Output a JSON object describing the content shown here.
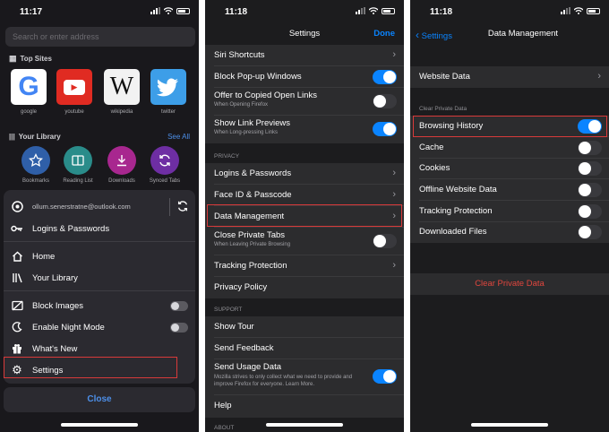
{
  "phone1": {
    "time": "11:17",
    "search_placeholder": "Search or enter address",
    "top_sites_title": "Top Sites",
    "sites": [
      {
        "label": "google",
        "icon": "google-icon"
      },
      {
        "label": "youtube",
        "icon": "youtube-icon"
      },
      {
        "label": "wikipedia",
        "icon": "wikipedia-icon"
      },
      {
        "label": "twitter",
        "icon": "twitter-icon"
      }
    ],
    "library_title": "Your Library",
    "see_all": "See All",
    "library": [
      {
        "label": "Bookmarks",
        "icon": "star-icon",
        "color": "#2f5fa8"
      },
      {
        "label": "Reading List",
        "icon": "book-icon",
        "color": "#2a8c8a"
      },
      {
        "label": "Downloads",
        "icon": "download-icon",
        "color": "#a8278f"
      },
      {
        "label": "Synced Tabs",
        "icon": "sync-icon",
        "color": "#6e2ea3"
      }
    ],
    "account_email": "ollum.senerstratne@outlook.com",
    "menu": {
      "logins": "Logins & Passwords",
      "home": "Home",
      "your_library": "Your Library",
      "block_images": "Block Images",
      "night_mode": "Enable Night Mode",
      "whats_new": "What's New",
      "settings": "Settings"
    },
    "close": "Close"
  },
  "phone2": {
    "time": "11:18",
    "title": "Settings",
    "done": "Done",
    "rows_top": [
      {
        "label": "Siri Shortcuts",
        "control": "chevron"
      },
      {
        "label": "Block Pop-up Windows",
        "control": "toggle",
        "on": true
      },
      {
        "label": "Offer to Copied Open Links",
        "sub": "When Opening Firefox",
        "control": "toggle",
        "on": false
      },
      {
        "label": "Show Link Previews",
        "sub": "When Long-pressing Links",
        "control": "toggle",
        "on": true
      }
    ],
    "privacy_header": "Privacy",
    "privacy_rows": [
      {
        "label": "Logins & Passwords",
        "control": "chevron"
      },
      {
        "label": "Face ID & Passcode",
        "control": "chevron"
      },
      {
        "label": "Data Management",
        "control": "chevron"
      },
      {
        "label": "Close Private Tabs",
        "sub": "When Leaving Private Browsing",
        "control": "toggle",
        "on": false
      },
      {
        "label": "Tracking Protection",
        "control": "chevron"
      },
      {
        "label": "Privacy Policy",
        "control": "none"
      }
    ],
    "support_header": "Support",
    "support_rows": [
      {
        "label": "Show Tour",
        "control": "none"
      },
      {
        "label": "Send Feedback",
        "control": "none"
      },
      {
        "label": "Send Usage Data",
        "sub": "Mozilla strives to only collect what we need to provide and improve Firefox for everyone. Learn More.",
        "control": "toggle",
        "on": true
      },
      {
        "label": "Help",
        "control": "none"
      }
    ],
    "about_header": "About"
  },
  "phone3": {
    "time": "11:18",
    "back": "Settings",
    "title": "Data Management",
    "website_data": "Website Data",
    "clear_header": "Clear Private Data",
    "items": [
      {
        "label": "Browsing History",
        "on": true
      },
      {
        "label": "Cache",
        "on": false
      },
      {
        "label": "Cookies",
        "on": false
      },
      {
        "label": "Offline Website Data",
        "on": false
      },
      {
        "label": "Tracking Protection",
        "on": false
      },
      {
        "label": "Downloaded Files",
        "on": false
      }
    ],
    "clear_button": "Clear Private Data"
  },
  "colors": {
    "accent": "#0a84ff",
    "highlight": "#d83a3a",
    "destructive": "#e0463e"
  }
}
